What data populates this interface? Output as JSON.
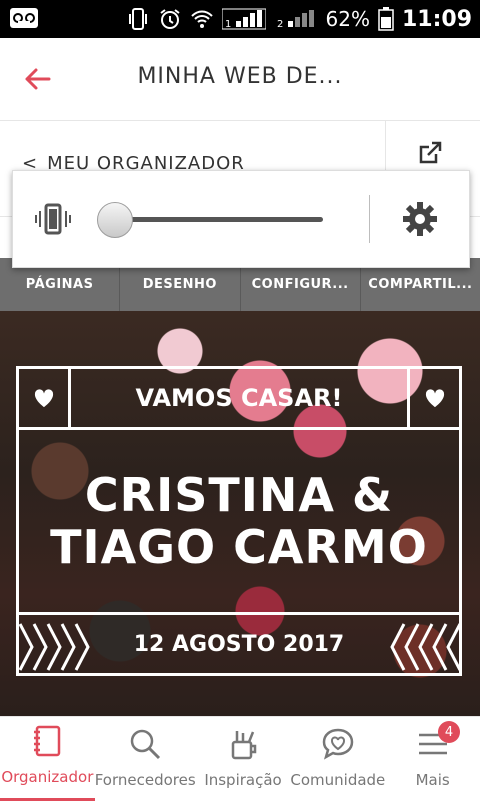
{
  "status_bar": {
    "battery": "62%",
    "time": "11:09",
    "sim1": "1",
    "sim2": "2"
  },
  "app_bar": {
    "title": "MINHA WEB DE..."
  },
  "subnav": {
    "breadcrumb_chevron": "<",
    "breadcrumb_label": "MEU ORGANIZADOR"
  },
  "volume_overlay": {
    "level": 0.0
  },
  "tabs": [
    {
      "label": "PÁGINAS"
    },
    {
      "label": "DESENHO"
    },
    {
      "label": "CONFIGUR..."
    },
    {
      "label": "COMPARTIL..."
    }
  ],
  "hero": {
    "header": "VAMOS CASAR!",
    "names_line1": "CRISTINA &",
    "names_line2": "TIAGO CARMO",
    "date": "12 AGOSTO 2017"
  },
  "bottom_nav": [
    {
      "label": "Organizador",
      "icon": "notebook-icon"
    },
    {
      "label": "Fornecedores",
      "icon": "search-icon"
    },
    {
      "label": "Inspiração",
      "icon": "brushes-icon"
    },
    {
      "label": "Comunidade",
      "icon": "chat-heart-icon"
    },
    {
      "label": "Mais",
      "icon": "menu-icon",
      "badge": "4"
    }
  ],
  "colors": {
    "accent": "#e04b5a",
    "tabs_bg": "#6e6e6e"
  }
}
